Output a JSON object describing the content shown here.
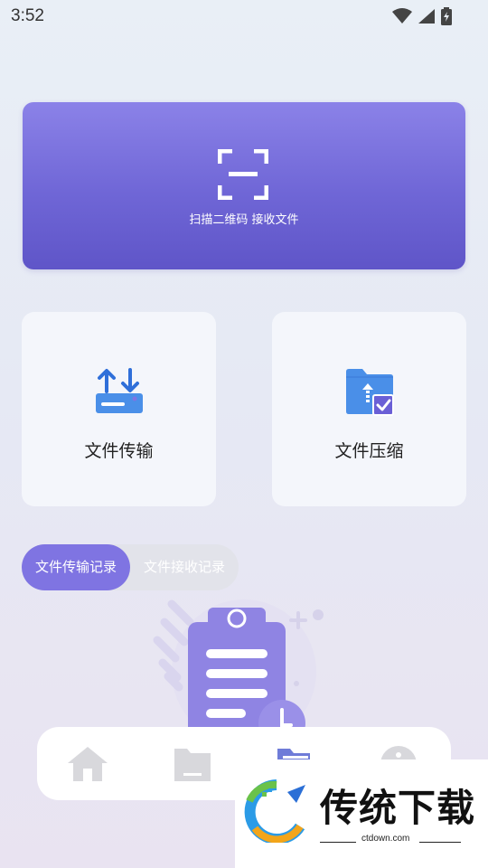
{
  "status_bar": {
    "time": "3:52",
    "icons": [
      "wifi-icon",
      "signal-icon",
      "battery-charging-icon"
    ]
  },
  "scan": {
    "icon": "scan-qr-icon",
    "label": "扫描二维码 接收文件"
  },
  "features": [
    {
      "icon": "file-transfer-icon",
      "label": "文件传输"
    },
    {
      "icon": "file-compress-icon",
      "label": "文件压缩"
    }
  ],
  "record_tabs": {
    "active": "文件传输记录",
    "inactive": "文件接收记录"
  },
  "bottom_nav": [
    "home-icon",
    "folder-icon",
    "folder-open-icon",
    "info-icon"
  ],
  "watermark": {
    "title": "传统下载",
    "url": "ctdown.com"
  },
  "colors": {
    "primary": "#7f74e2",
    "card_bg": "#f4f6fb",
    "icon_blue": "#4a8fe8"
  }
}
